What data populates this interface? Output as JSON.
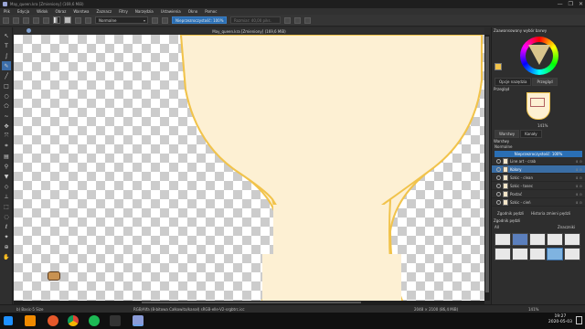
{
  "window": {
    "title": "May_queen.kra [Zmieniony] (169,6 MiB)",
    "buttons": [
      "—",
      "❐",
      "✕"
    ]
  },
  "menu": [
    "Plik",
    "Edycja",
    "Widok",
    "Obraz",
    "Warstwa",
    "Zaznacz",
    "Filtry",
    "Narzędzia",
    "Ustawienia",
    "Okno",
    "Pomoc"
  ],
  "tool_options": {
    "blend_mode": "Normalne",
    "opacity_label": "Nieprzezroczystość: 100%",
    "size_label": "Rozmiar: 40,00 piks."
  },
  "document": {
    "tab_title": "May_queen.kra [Zmieniony] (169,6 MiB)"
  },
  "status": {
    "brush": "b) Basic-5 Size",
    "color": "RGB/Alfa (8-bitowa Całkowita/kanał) sRGB-elle-V2-srgbtrc.icc",
    "size": "2048 × 2100 (86,4 MiB)",
    "zoom": "141%"
  },
  "taskbar": {
    "time": "19:27",
    "date": "2020-05-03"
  },
  "dock": {
    "color_panel_title": "Zaawansowany wybór barwy",
    "tabs_top": [
      "Opcje nazędzia",
      "Przegląd"
    ],
    "overview_title": "Przegląd",
    "overview_zoom": "141%",
    "tabs_layers": [
      "Warstwy",
      "Kanały"
    ],
    "layers_title": "Warstwy",
    "blend": "Normalne",
    "opacity": "Nieprzezroczystość: 100%",
    "layers": [
      {
        "name": "Line art - crab",
        "selected": false
      },
      {
        "name": "Kolory",
        "selected": true
      },
      {
        "name": "Szkic - clean",
        "selected": false
      },
      {
        "name": "Szkic - tosec",
        "selected": false
      },
      {
        "name": "Postać",
        "selected": false
      },
      {
        "name": "Szkic - cień",
        "selected": false
      }
    ],
    "layer_actions": [
      "Zgodnik pędzli",
      "Historia zmieni pędzli"
    ],
    "brush_panel_title": "Zgodnik pędzli",
    "brush_tag": "Znaczniki",
    "brush_search": "All"
  },
  "colors": {
    "skin": "#fdf0d3",
    "outline": "#f1c34b",
    "accent": "#3a6ea5"
  }
}
